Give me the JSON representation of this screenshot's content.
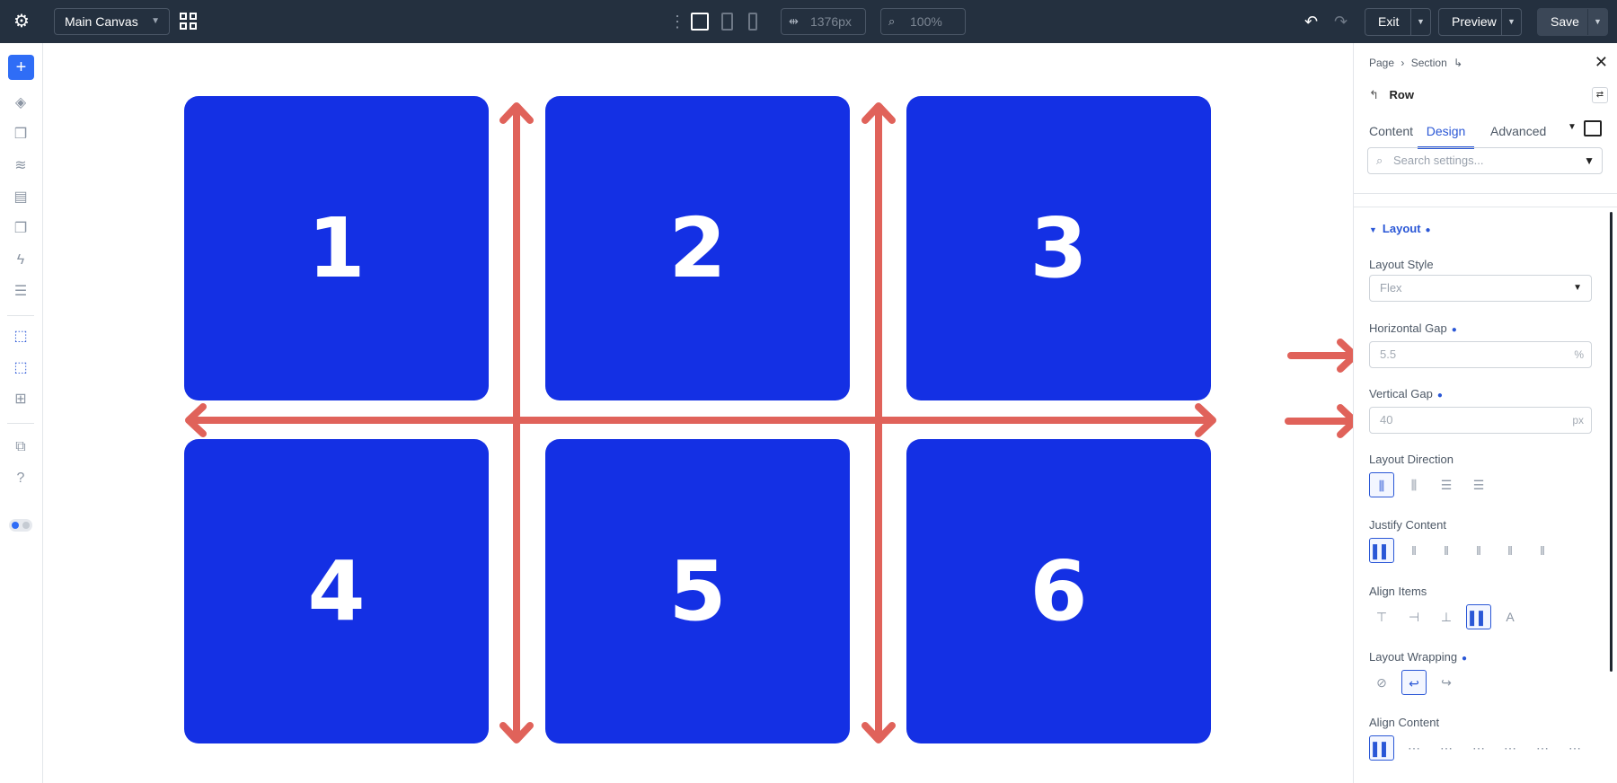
{
  "topbar": {
    "canvas_select": "Main Canvas",
    "width_value": "1376px",
    "zoom_value": "100%",
    "exit_label": "Exit",
    "preview_label": "Preview",
    "save_label": "Save"
  },
  "canvas": {
    "boxes": [
      "1",
      "2",
      "3",
      "4",
      "5",
      "6"
    ],
    "accent_color": "#1430e4",
    "arrow_color": "#e0625a"
  },
  "panel": {
    "breadcrumb": [
      "Page",
      "Section"
    ],
    "title": "Row",
    "tabs": [
      "Content",
      "Design",
      "Advanced"
    ],
    "active_tab": "Design",
    "search_placeholder": "Search settings...",
    "section_title": "Layout",
    "layout_style": {
      "label": "Layout Style",
      "value": "Flex"
    },
    "horizontal_gap": {
      "label": "Horizontal Gap",
      "value": "5.5",
      "unit": "%"
    },
    "vertical_gap": {
      "label": "Vertical Gap",
      "value": "40",
      "unit": "px"
    },
    "layout_direction": {
      "label": "Layout Direction"
    },
    "justify_content": {
      "label": "Justify Content"
    },
    "align_items": {
      "label": "Align Items"
    },
    "layout_wrapping": {
      "label": "Layout Wrapping"
    },
    "align_content": {
      "label": "Align Content"
    }
  }
}
